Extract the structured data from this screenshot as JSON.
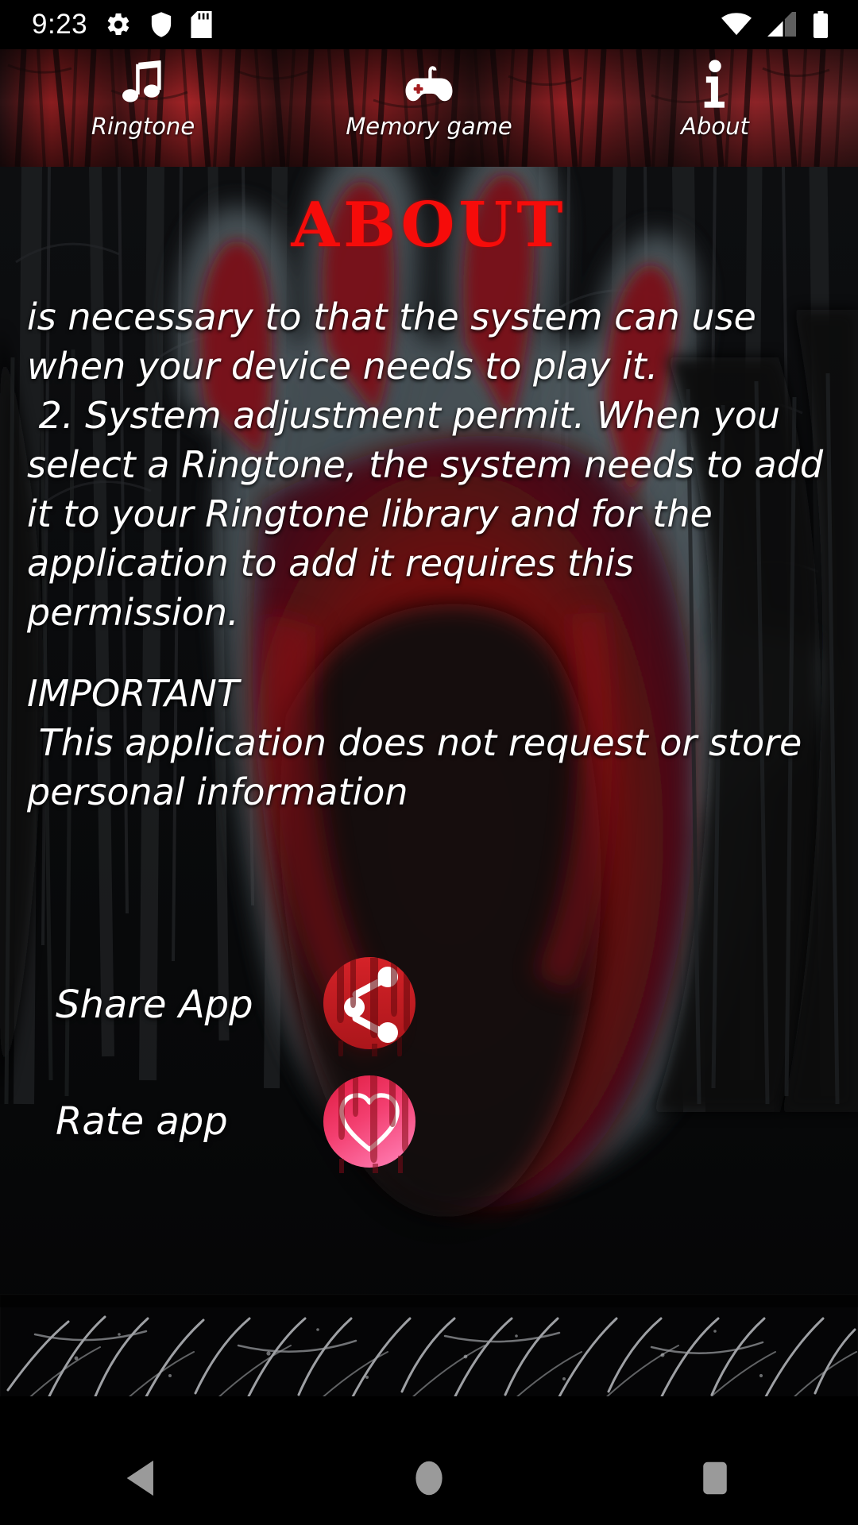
{
  "status_bar": {
    "time": "9:23",
    "left_icons": [
      "gear-icon",
      "shield-icon",
      "sd-card-icon"
    ],
    "right_icons": [
      "wifi-icon",
      "cellular-signal-icon",
      "battery-icon"
    ]
  },
  "tabs": [
    {
      "label": "Ringtone",
      "icon": "music-note-icon",
      "selected": false
    },
    {
      "label": "Memory game",
      "icon": "gamepad-icon",
      "selected": false
    },
    {
      "label": "About",
      "icon": "info-icon",
      "selected": true
    }
  ],
  "page": {
    "title": "ABOUT",
    "paragraph_1": "is necessary to that the system can use when your device needs to play it.",
    "paragraph_2": " 2. System adjustment permit. When you select a Ringtone, the system needs to add it to your Ringtone library and for the application to add it requires this permission.",
    "important_heading": "IMPORTANT",
    "important_body": " This application does not request or store personal information"
  },
  "actions": [
    {
      "label": "Share App",
      "icon": "share-nodes-icon"
    },
    {
      "label": "Rate app",
      "icon": "heart-icon"
    }
  ],
  "nav_bar": {
    "back": "back-triangle-icon",
    "home": "home-circle-icon",
    "recents": "recents-square-icon"
  },
  "colors": {
    "title_red": "#f60c0a",
    "share_circle": "#c4191f",
    "rate_gradient_top": "#e8264f",
    "rate_gradient_bottom": "#ff74ab",
    "text_white": "#ffffff",
    "blood_dark": "#6e0a10",
    "blood_mid": "#8d1017",
    "nav_icon_gray": "#9a9a9a",
    "background_black": "#000000"
  }
}
